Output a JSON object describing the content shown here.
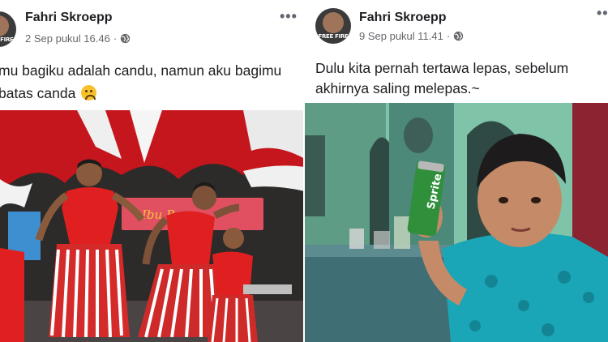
{
  "posts": [
    {
      "author": "Fahri Skroepp",
      "avatar_text": "FREE FIRE",
      "date": "2 Sep pukul 16.46",
      "separator": "·",
      "privacy_icon": "globe-icon",
      "more_label": "•••",
      "caption_line1": "mu bagiku adalah candu, namun aku bagimu",
      "caption_line2": "batas canda",
      "emoji": "frowning-face",
      "photo": "children in red shirts and red-white fringed skirts dancing on a stage with red and white drapes",
      "banner_text": "Ibu Baru"
    },
    {
      "author": "Fahri Skroepp",
      "avatar_text": "FREE FIRE",
      "date": "9 Sep pukul 11.41",
      "separator": "·",
      "privacy_icon": "globe-icon",
      "more_label": "•••",
      "caption_line1": "Dulu kita pernah tertawa lepas, sebelum",
      "caption_line2": "akhirnya saling melepas.~",
      "photo": "boy in blue batik shirt holding a green soda can",
      "can_text": "Sprite"
    }
  ],
  "colors": {
    "name": "#1c1e21",
    "meta": "#65676b",
    "red_drape": "#c4161c",
    "wall_green": "#7fc3a8",
    "batik_blue": "#1aa6b7"
  }
}
